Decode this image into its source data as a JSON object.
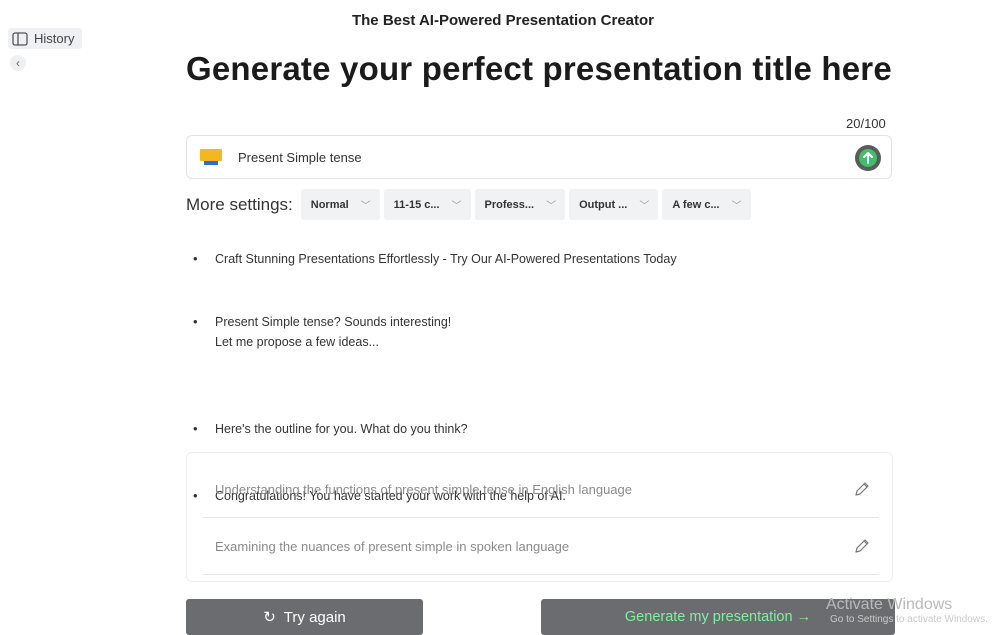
{
  "sidebar": {
    "history_label": "History",
    "collapse_icon": "chevron-left-icon"
  },
  "header": {
    "tagline": "The Best AI-Powered Presentation Creator",
    "title": "Generate your perfect presentation title here"
  },
  "input": {
    "counter": "20/100",
    "value": "Present Simple tense",
    "send_icon": "arrow-up-icon"
  },
  "settings": {
    "label": "More settings:",
    "dropdowns": [
      "Normal",
      "11-15 c...",
      "Profess...",
      "Output ...",
      "A few c..."
    ]
  },
  "messages": [
    "Craft Stunning Presentations Effortlessly - Try Our AI-Powered Presentations Today",
    "Present Simple tense? Sounds interesting!",
    "Let me propose a few ideas...",
    "Here's the outline for you. What do you think?",
    "Congratulations! You have started your work with the help of AI."
  ],
  "outline": [
    "Understanding the functions of present simple tense in English language",
    "Examining the nuances of present simple in spoken language"
  ],
  "actions": {
    "try_again": "Try again",
    "generate": "Generate my presentation →"
  },
  "watermark": {
    "line1": "Activate Windows",
    "line2": "Go to Settings to activate Windows."
  },
  "colors": {
    "accent_green": "#7ff0a0",
    "button_gray": "#6b6c70",
    "send_green": "#3fbf6b"
  }
}
